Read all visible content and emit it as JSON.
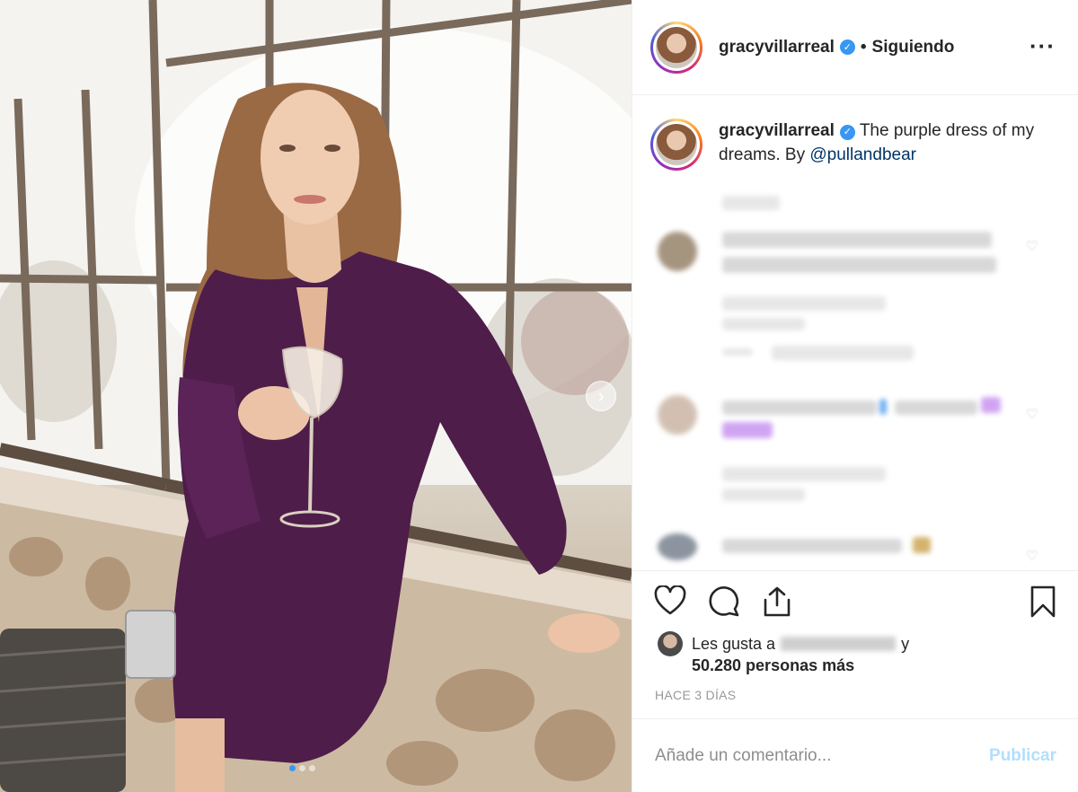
{
  "post": {
    "username": "gracyvillarreal",
    "verified_icon": "verified-badge-icon",
    "separator": "•",
    "follow_label": "Siguiendo",
    "more_label": "···",
    "caption_text": "The purple dress of my dreams. By",
    "caption_mention": "@pullandbear",
    "carousel": {
      "next_icon": "chevron-right-icon",
      "slides": 3,
      "active_slide": 1
    }
  },
  "actions": {
    "like_icon": "heart-icon",
    "comment_icon": "comment-bubble-icon",
    "share_icon": "share-icon",
    "save_icon": "bookmark-icon"
  },
  "likes": {
    "prefix": "Les gusta a",
    "suffix": "y",
    "count_text": "50.280 personas más"
  },
  "timestamp": "HACE 3 DÍAS",
  "comment_box": {
    "placeholder": "Añade un comentario...",
    "publish_label": "Publicar"
  },
  "colors": {
    "verified": "#3897f0",
    "mention": "#003569",
    "publish_disabled": "#b2dffc",
    "muted": "#8e8e8e"
  }
}
